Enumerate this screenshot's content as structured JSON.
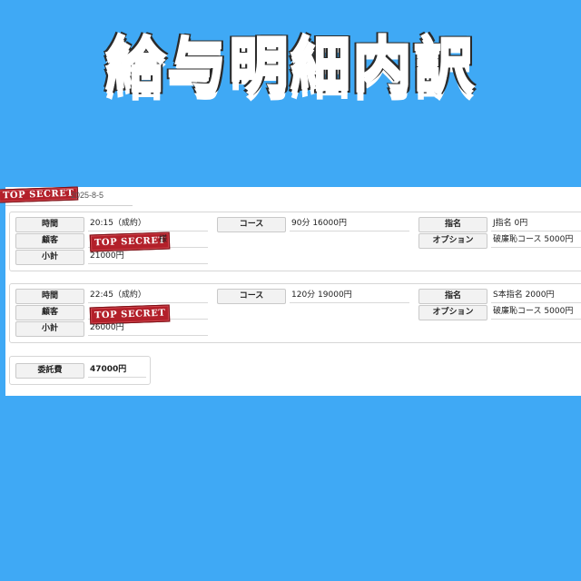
{
  "title": "給与明細内訳",
  "header": {
    "stamp": "TOP SECRET",
    "date": "2025-8-5"
  },
  "orders": [
    {
      "time_label": "時間",
      "time_value": "20:15（成約）",
      "customer_label": "顧客",
      "customer_stamp": "TOP SECRET",
      "customer_suffix": "様",
      "subtotal_label": "小計",
      "subtotal_value": "21000円",
      "course_label": "コース",
      "course_value": "90分 16000円",
      "nomination_label": "指名",
      "nomination_value": "J指名 0円",
      "option_label": "オプション",
      "option_value": "破廉恥コース 5000円"
    },
    {
      "time_label": "時間",
      "time_value": "22:45（成約）",
      "customer_label": "顧客",
      "customer_stamp": "TOP SECRET",
      "customer_suffix": "",
      "subtotal_label": "小計",
      "subtotal_value": "26000円",
      "course_label": "コース",
      "course_value": "120分 19000円",
      "nomination_label": "指名",
      "nomination_value": "S本指名 2000円",
      "option_label": "オプション",
      "option_value": "破廉恥コース 5000円"
    }
  ],
  "fee": {
    "label": "委託費",
    "value": "47000円"
  }
}
